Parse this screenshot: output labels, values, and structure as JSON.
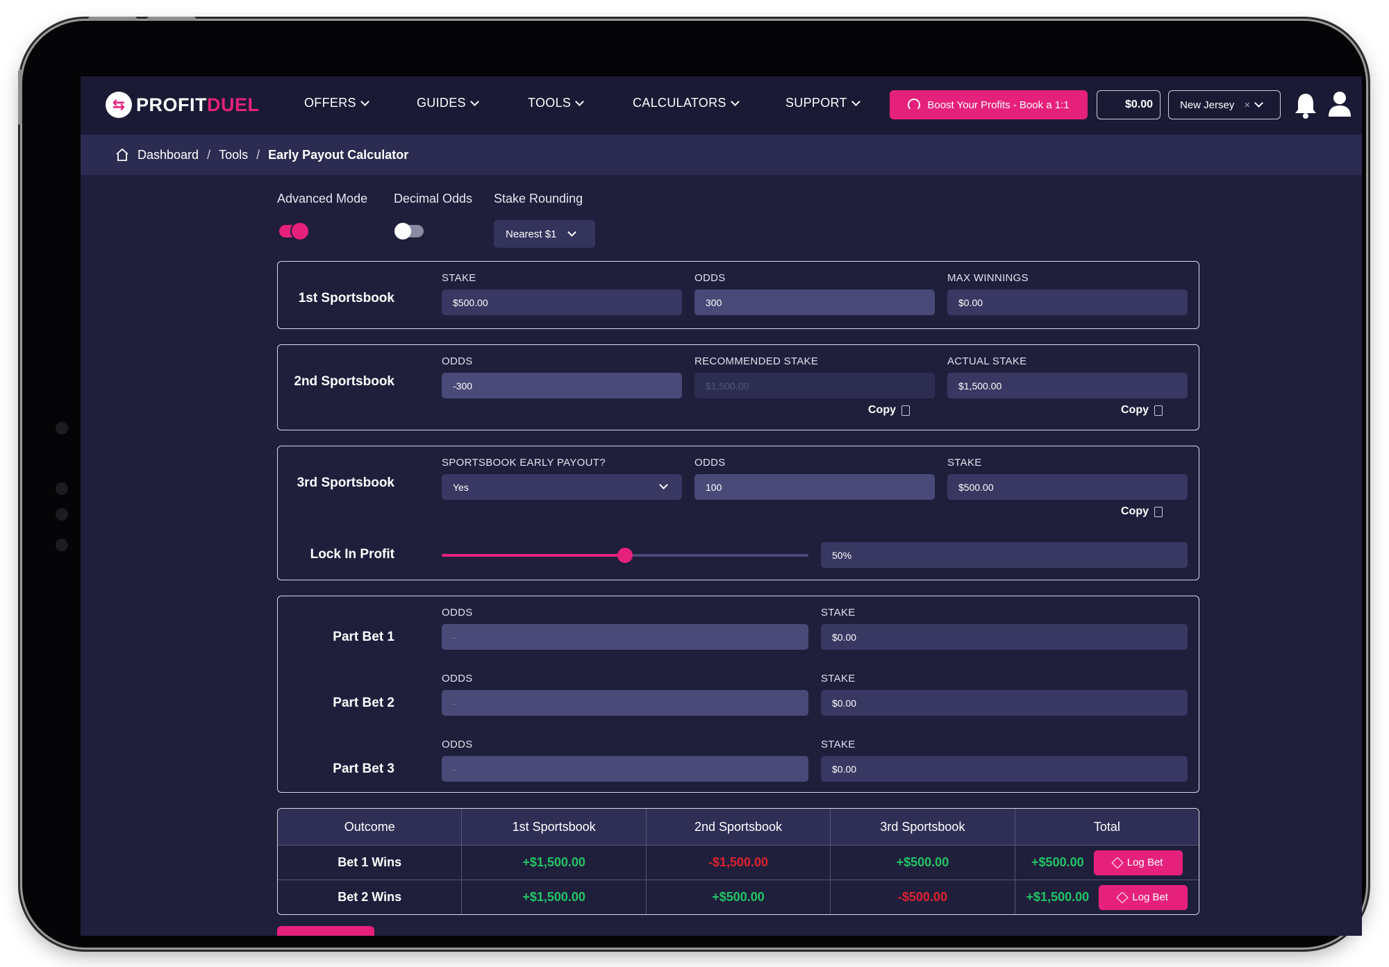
{
  "nav": {
    "logo_a": "PROFIT",
    "logo_b": "DUEL",
    "items": [
      "OFFERS",
      "GUIDES",
      "TOOLS",
      "CALCULATORS",
      "SUPPORT"
    ],
    "boost_label": "Boost Your Profits - Book a 1:1",
    "balance": "$0.00",
    "state": "New Jersey",
    "state_clear": "×"
  },
  "breadcrumb": {
    "items": [
      "Dashboard",
      "Tools"
    ],
    "current": "Early Payout Calculator",
    "separator": "/"
  },
  "settings": {
    "advanced_mode_label": "Advanced Mode",
    "advanced_mode_on": true,
    "decimal_odds_label": "Decimal Odds",
    "decimal_odds_on": false,
    "stake_rounding_label": "Stake Rounding",
    "stake_rounding_value": "Nearest $1"
  },
  "sportsbook1": {
    "title": "1st Sportsbook",
    "stake_label": "STAKE",
    "stake": "$500.00",
    "odds_label": "ODDS",
    "odds": "300",
    "max_label": "MAX WINNINGS",
    "max": "$0.00"
  },
  "sportsbook2": {
    "title": "2nd Sportsbook",
    "odds_label": "ODDS",
    "odds": "-300",
    "rec_label": "RECOMMENDED STAKE",
    "rec_placeholder": "$1,500.00",
    "actual_label": "ACTUAL STAKE",
    "actual": "$1,500.00",
    "copy_label": "Copy"
  },
  "sportsbook3": {
    "title": "3rd Sportsbook",
    "early_label": "SPORTSBOOK EARLY PAYOUT?",
    "early": "Yes",
    "odds_label": "ODDS",
    "odds": "100",
    "stake_label": "STAKE",
    "stake": "$500.00",
    "copy_label": "Copy",
    "lock_label": "Lock In Profit",
    "lock_value": "50%",
    "lock_fraction": 0.5
  },
  "part_bets": [
    {
      "title": "Part Bet 1",
      "odds_label": "ODDS",
      "odds": "-",
      "stake_label": "STAKE",
      "stake": "$0.00"
    },
    {
      "title": "Part Bet 2",
      "odds_label": "ODDS",
      "odds": "-",
      "stake_label": "STAKE",
      "stake": "$0.00"
    },
    {
      "title": "Part Bet 3",
      "odds_label": "ODDS",
      "odds": "-",
      "stake_label": "STAKE",
      "stake": "$0.00"
    }
  ],
  "results": {
    "headers": [
      "Outcome",
      "1st Sportsbook",
      "2nd Sportsbook",
      "3rd Sportsbook",
      "Total"
    ],
    "log_label": "Log Bet",
    "rows": [
      {
        "outcome": "Bet 1 Wins",
        "sb1": "+$1,500.00",
        "sb2": "-$1,500.00",
        "sb3": "+$500.00",
        "total": "+$500.00"
      },
      {
        "outcome": "Bet 2 Wins",
        "sb1": "+$1,500.00",
        "sb2": "+$500.00",
        "sb3": "-$500.00",
        "total": "+$1,500.00"
      }
    ]
  },
  "colors": {
    "accent": "#e6217c",
    "positive": "#22c465",
    "negative": "#e0212e",
    "background": "#1f1f3c"
  }
}
